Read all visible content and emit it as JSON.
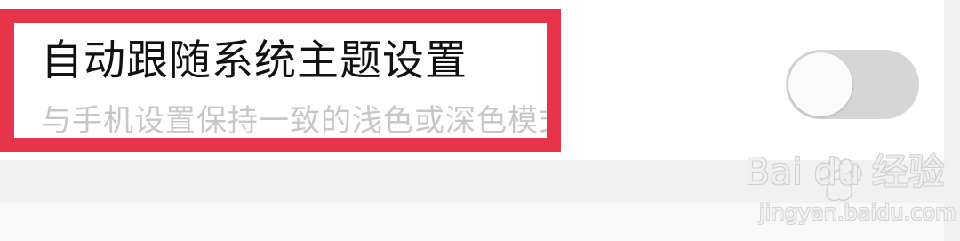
{
  "setting": {
    "title": "自动跟随系统主题设置",
    "description": "与手机设置保持一致的浅色或深色模式",
    "toggle_state": "off"
  },
  "annotation": {
    "highlight_color": "#e8344a"
  },
  "watermark": {
    "logo_text": "Bai du 经验",
    "site_text": "jingyan.baidu.com"
  },
  "colors": {
    "background": "#ffffff",
    "toggle_track": "#d6d6d6",
    "toggle_knob": "#fafafa",
    "title_text": "#111111",
    "description_text": "#c7c7c7"
  }
}
